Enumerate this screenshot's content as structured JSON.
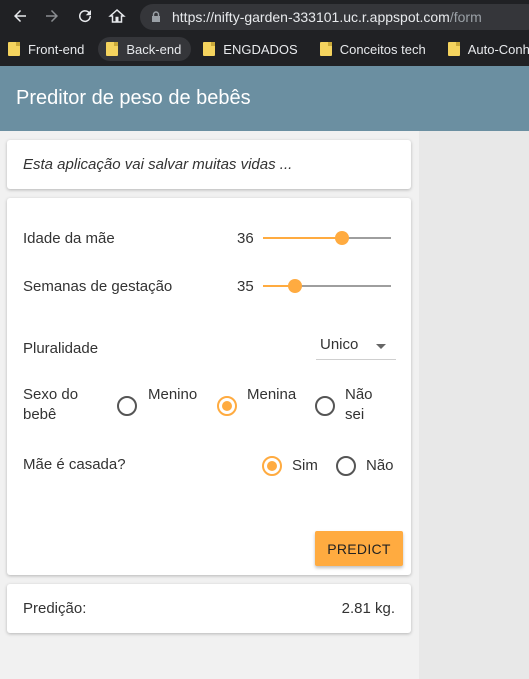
{
  "browser": {
    "url_base": "https://nifty-garden-333101.uc.r.appspot.com",
    "url_path": "/form",
    "bookmarks": [
      "Front-end",
      "Back-end",
      "ENGDADOS",
      "Conceitos tech",
      "Auto-Conhecime"
    ]
  },
  "app": {
    "title": "Preditor de peso de bebês",
    "tagline": "Esta aplicação vai salvar muitas vidas ..."
  },
  "form": {
    "mother_age": {
      "label": "Idade da mãe",
      "value": 36,
      "fraction": 0.62
    },
    "gestation_weeks": {
      "label": "Semanas de gestação",
      "value": 35,
      "fraction": 0.25
    },
    "plurality": {
      "label": "Pluralidade",
      "selected": "Unico"
    },
    "baby_sex": {
      "label_line1": "Sexo do",
      "label_line2": "bebê",
      "options": [
        "Menino",
        "Menina",
        "Não sei"
      ],
      "option3_line1": "Não",
      "option3_line2": "sei",
      "selected": "Menina"
    },
    "married": {
      "label": "Mãe é casada?",
      "options": [
        "Sim",
        "Não"
      ],
      "selected": "Sim"
    },
    "predict_label": "PREDICT"
  },
  "prediction": {
    "label": "Predição:",
    "value": "2.81 kg."
  },
  "colors": {
    "accent": "#ffab40",
    "appbar": "#6b8fa1",
    "chrome": "#202124"
  }
}
